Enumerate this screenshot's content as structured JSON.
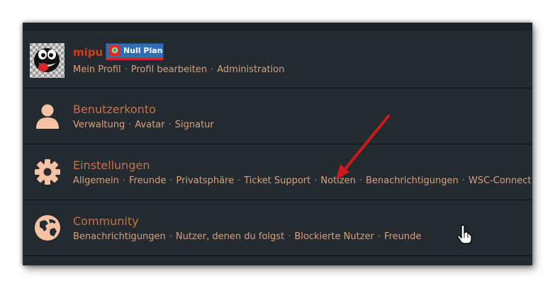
{
  "colors": {
    "panel_bg": "#232b31",
    "title": "#c9704b",
    "username": "#d43b1c",
    "link": "#d6a07d",
    "icon": "#f5c2a3",
    "annotation_arrow": "#cc1a1a"
  },
  "user": {
    "name": "mipu",
    "badge": "Null Plan",
    "links": [
      "Mein Profil",
      "Profil bearbeiten",
      "Administration"
    ]
  },
  "sections": [
    {
      "icon": "user-icon",
      "title": "Benutzerkonto",
      "links": [
        "Verwaltung",
        "Avatar",
        "Signatur"
      ]
    },
    {
      "icon": "gear-icon",
      "title": "Einstellungen",
      "links": [
        "Allgemein",
        "Freunde",
        "Privatsphäre",
        "Ticket Support",
        "Notizen",
        "Benachrichtigungen",
        "WSC-Connect"
      ]
    },
    {
      "icon": "globe-icon",
      "title": "Community",
      "links": [
        "Benachrichtigungen",
        "Nutzer, denen du folgst",
        "Blockierte Nutzer",
        "Freunde"
      ]
    }
  ],
  "separator": "·"
}
